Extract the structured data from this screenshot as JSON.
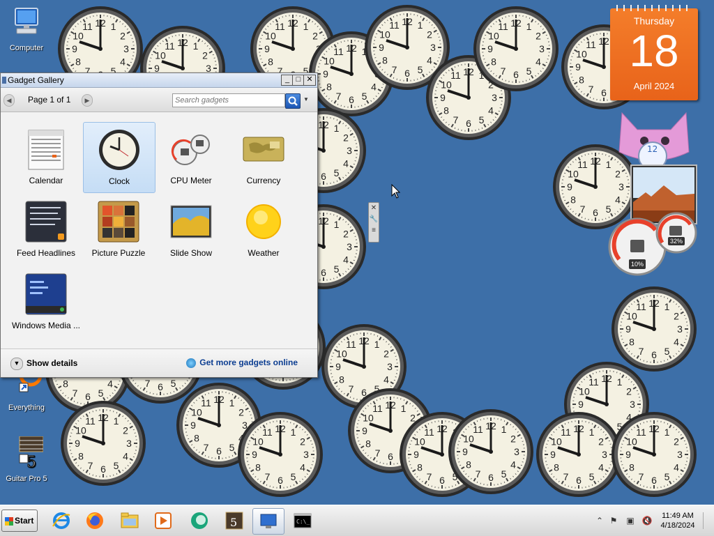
{
  "desktop_icons": [
    {
      "label": "Computer"
    },
    {
      "label": "Everything"
    },
    {
      "label": "Guitar Pro 5"
    }
  ],
  "calendar_gadget": {
    "weekday": "Thursday",
    "date": "18",
    "month_year": "April 2024"
  },
  "cpu_meter": {
    "cpu": "10%",
    "memory": "32%"
  },
  "gallery": {
    "title": "Gadget Gallery",
    "page_label": "Page 1 of 1",
    "search_placeholder": "Search gadgets",
    "show_details": "Show details",
    "get_more": "Get more gadgets online",
    "gadgets": [
      {
        "label": "Calendar"
      },
      {
        "label": "Clock",
        "selected": true
      },
      {
        "label": "CPU Meter"
      },
      {
        "label": "Currency"
      },
      {
        "label": "Feed Headlines"
      },
      {
        "label": "Picture Puzzle"
      },
      {
        "label": "Slide Show"
      },
      {
        "label": "Weather"
      },
      {
        "label": "Windows Media ..."
      }
    ]
  },
  "taskbar": {
    "start_label": "Start",
    "time": "11:49 AM",
    "date": "4/18/2024",
    "apps": [
      "internet-explorer-icon",
      "firefox-icon",
      "explorer-folder-icon",
      "media-player-icon",
      "chat-app-icon",
      "guitar-pro-icon",
      "remote-desktop-icon",
      "command-prompt-icon"
    ]
  }
}
